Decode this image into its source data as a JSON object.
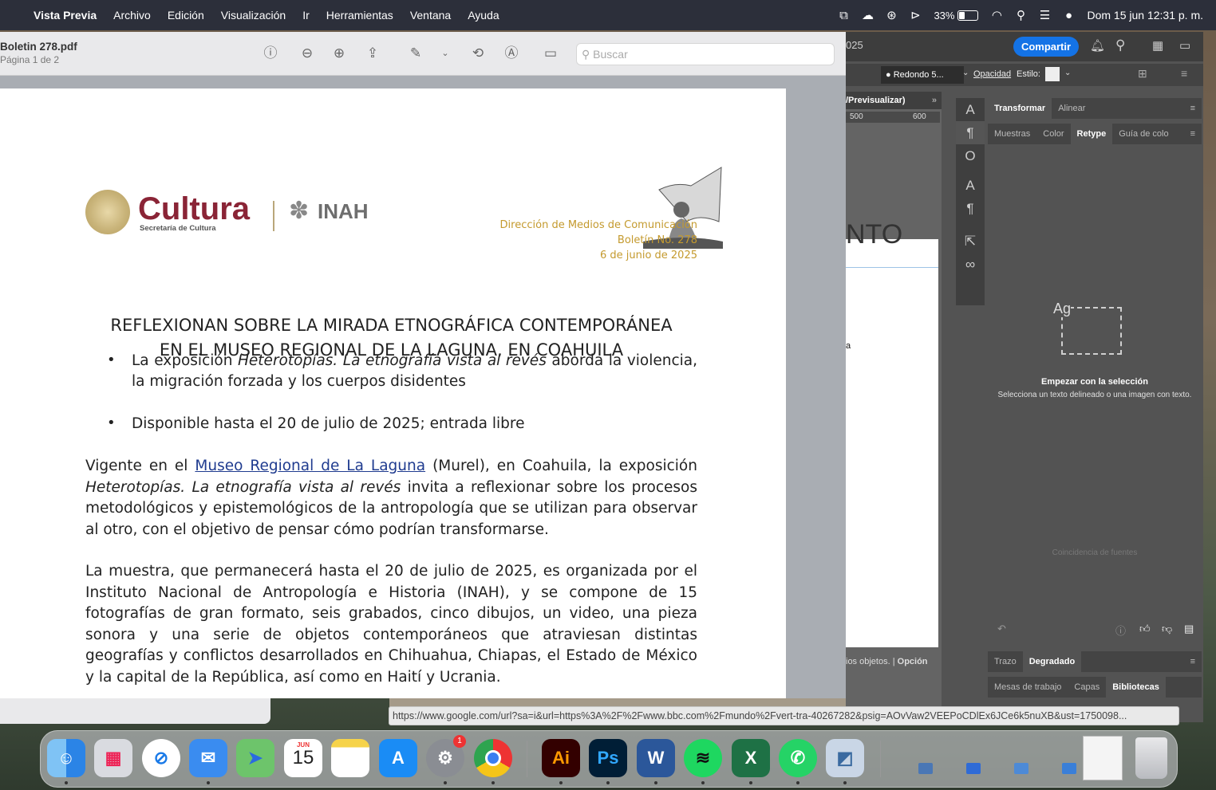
{
  "menubar": {
    "app_name": "Vista Previa",
    "items": [
      "Archivo",
      "Edición",
      "Visualización",
      "Ir",
      "Herramientas",
      "Ventana",
      "Ayuda"
    ],
    "battery_percent": "33%",
    "battery_level": 0.33,
    "clock": "Dom 15 jun 12:31 p. m."
  },
  "preview": {
    "filename": "Boletin 278.pdf",
    "page_info": "Página 1 de 2",
    "search_placeholder": "Buscar"
  },
  "document": {
    "logo_cultura": "Cultura",
    "logo_secretaria": "Secretaría de Cultura",
    "logo_inah": "INAH",
    "header_lines": [
      "Dirección de Medios de Comunicación",
      "Boletín No. 278",
      "6 de junio de 2025"
    ],
    "headline_line1": "REFLEXIONAN SOBRE LA MIRADA ETNOGRÁFICA CONTEMPORÁNEA",
    "headline_line2": "EN EL MUSEO REGIONAL DE LA LAGUNA, EN COAHUILA",
    "bullet1_pre": "La exposición ",
    "bullet1_italic": "Heterotopías. La etnografía vista al revés",
    "bullet1_post": " aborda la violencia, la migración forzada y los cuerpos disidentes",
    "bullet2": "Disponible hasta el 20 de julio de 2025; entrada libre",
    "para1_pre": "Vigente en el ",
    "para1_link": "Museo Regional de La Laguna",
    "para1_mid": " (Murel), en Coahuila, la exposición ",
    "para1_italic": "Heterotopías. La etnografía vista al revés",
    "para1_post": " invita a reflexionar sobre los procesos metodológicos y epistemológicos de la antropología que se utilizan para observar al otro, con el objetivo de pensar cómo podrían transformarse.",
    "para2": "La muestra, que permanecerá hasta el 20 de julio de 2025, es organizada por el Instituto Nacional de Antropología e Historia (INAH), y se compone de 15 fotografías de gran formato, seis grabados, cinco dibujos, un video, una pieza sonora y una serie de objetos contemporáneos que atraviesan distintas geografías y conflictos desarrollados en Chihuahua, Chiapas, el Estado de México y la capital de la República, así como en Haití y Ucrania."
  },
  "illustrator": {
    "year_fragment": "025",
    "share_label": "Compartir",
    "brush_label": "Redondo 5...",
    "opacity_label": "Opacidad",
    "style_label": "Estilo:",
    "doc_tab": "/Previsualizar)",
    "ruler_500": "500",
    "ruler_600": "600",
    "canvas_text": "NTO",
    "canvas_letter": "a",
    "status_text": "ios objetos.",
    "status_option": "Opción",
    "panel_tabs_top": [
      "Transformar",
      "Alinear"
    ],
    "panel_tabs_mid": [
      "Muestras",
      "Color",
      "Retype",
      "Guía de colo"
    ],
    "retype_icon_text": "Ag",
    "retype_heading": "Empezar con la selección",
    "retype_desc": "Selecciona un texto delineado o una imagen con texto.",
    "font_match": "Coincidencia de fuentes",
    "panel_tabs_bottom1": [
      "Trazo",
      "Degradado"
    ],
    "panel_tabs_bottom2": [
      "Mesas de trabajo",
      "Capas",
      "Bibliotecas"
    ]
  },
  "url_status": "https://www.google.com/url?sa=i&url=https%3A%2F%2Fwww.bbc.com%2Fmundo%2Fvert-tra-40267282&psig=AOvVaw2VEEPoCDlEx6JCe6k5nuXB&ust=1750098...",
  "dock": {
    "calendar_month": "JUN",
    "calendar_day": "15",
    "settings_badge": "1",
    "apps": [
      "finder-icon",
      "launchpad-icon",
      "safari-icon",
      "mail-icon",
      "maps-icon",
      "calendar-icon",
      "notes-icon",
      "app-store-icon",
      "settings-icon",
      "chrome-icon",
      "illustrator-icon",
      "photoshop-icon",
      "word-icon",
      "spotify-icon",
      "excel-icon",
      "whatsapp-icon",
      "preview-icon"
    ],
    "illustrator_label": "Ai",
    "photoshop_label": "Ps",
    "word_label": "W",
    "excel_label": "X"
  },
  "colors": {
    "menubar": "#2c2f3a",
    "gold": "#c49a2e",
    "cultura": "#8a2436",
    "link": "#1f3b8f",
    "share": "#1473e6"
  }
}
